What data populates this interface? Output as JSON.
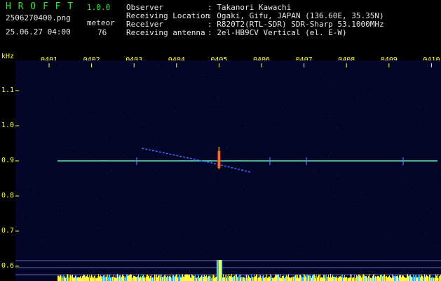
{
  "app": {
    "name": "H R O F F T",
    "version": "1.0.0"
  },
  "file": {
    "name": "2506270400.png",
    "datetime": "25.06.27 04:00"
  },
  "meteor": {
    "label": "meteor",
    "count": "76"
  },
  "info": {
    "rows": [
      {
        "key": "Observer",
        "value": ": Takanori Kawachi"
      },
      {
        "key": "Receiving Location",
        "value": ": Ogaki, Gifu, JAPAN (136.60E, 35.35N)"
      },
      {
        "key": "Receiver",
        "value": ": R820T2(RTL-SDR) SDR-Sharp 53.1000MHz"
      },
      {
        "key": "Receiving antenna",
        "value": ": 2el-HB9CV Vertical (el. E-W)"
      }
    ]
  },
  "colors": {
    "background": "#000000",
    "plot_bg": "#050528",
    "text_header": "#2ee82e",
    "text_info": "#e8e8e8",
    "ticks": "#ffff3a",
    "carrier": "#6fe3b5",
    "hist": "#ffff3a",
    "hist2": "#24b8ff"
  },
  "chart_data": {
    "type": "heatmap",
    "ylabel": "kHz",
    "x_ticks": [
      "0401",
      "0402",
      "0403",
      "0404",
      "0405",
      "0406",
      "0407",
      "0408",
      "0409",
      "0410"
    ],
    "y_ticks": [
      "1.1",
      "1.0",
      "0.9",
      "0.8",
      "0.7",
      "0.6"
    ],
    "y_values": [
      1.1,
      1.0,
      0.9,
      0.8,
      0.7,
      0.6
    ],
    "ylim": [
      0.58,
      1.18
    ],
    "carrier_khz": 0.9,
    "meteor_time": "0405"
  }
}
